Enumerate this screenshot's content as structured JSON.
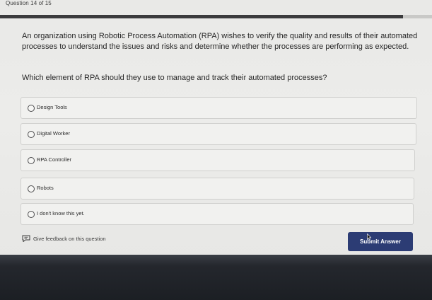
{
  "header": {
    "counter": "Question 14 of 15",
    "progress_fraction": 0.933
  },
  "question": {
    "text": "An organization using Robotic Process Automation (RPA) wishes to verify the quality and results of their automated processes to understand the issues and risks and determine whether the processes are performing as expected.",
    "prompt": "Which element of RPA should they use to manage and track their automated processes?"
  },
  "options": [
    {
      "label": "Design Tools"
    },
    {
      "label": "Digital Worker"
    },
    {
      "label": "RPA Controller"
    },
    {
      "label": "Robots"
    },
    {
      "label": "I don't know this yet."
    }
  ],
  "footer": {
    "feedback_label": "Give feedback on this question",
    "submit_label": "Submit Answer"
  },
  "colors": {
    "submit_bg": "#2c3c74",
    "progress_fill": "#3b3b3d"
  },
  "icons": {
    "feedback": "feedback-icon",
    "radio": "radio-icon",
    "cursor": "mouse-cursor-icon"
  }
}
